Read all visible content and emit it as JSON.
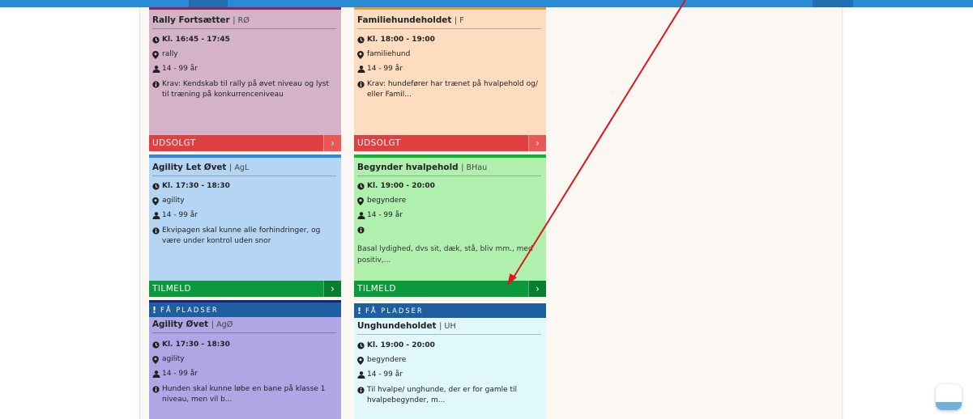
{
  "colors": {
    "accent": "#2b8ad6",
    "sold_out": "#e0403f",
    "register": "#0b9a3b",
    "few_seats": "#1d5fa0",
    "annotation_arrow": "#e0141b"
  },
  "icons": {
    "time": "clock-icon",
    "location": "map-marker-icon",
    "age": "user-icon",
    "info": "info-circle-icon",
    "action": "chevron-right-icon",
    "alert": "exclamation-icon"
  },
  "cards": [
    {
      "title": "Rally Fortsætter",
      "code": "RØ",
      "time": "Kl. 16:45 - 17:45",
      "location": "rally",
      "age": "14 - 99 år",
      "info": "Krav: Kendskab til rally på øvet niveau og lyst til træning på konkurrenceniveau",
      "action": "UDSOLGT"
    },
    {
      "title": "Familiehundeholdet",
      "code": "F",
      "time": "Kl. 18:00 - 19:00",
      "location": "familiehund",
      "age": "14 - 99 år",
      "info": "Krav: hundefører har trænet på hvalpehold og/ eller Famil...",
      "action": "UDSOLGT"
    },
    {
      "title": "Agility Let Øvet",
      "code": "AgL",
      "time": "Kl. 17:30 - 18:30",
      "location": "agility",
      "age": "14 - 99 år",
      "info": "Ekvipagen skal kunne alle forhindringer, og være under kontrol uden snor",
      "action": "TILMELD"
    },
    {
      "title": "Begynder hvalpehold",
      "code": "BHau",
      "time": "Kl. 19:00 - 20:00",
      "location": "begyndere",
      "age": "14 - 99 år",
      "info": "",
      "description": "Basal lydighed, dvs sit, dæk, stå, bliv mm., med positiv,...",
      "action": "TILMELD"
    },
    {
      "banner": "FÅ PLADSER",
      "title": "Agility Øvet",
      "code": "AgØ",
      "time": "Kl. 17:30 - 18:30",
      "location": "agility",
      "age": "14 - 99 år",
      "info": "Hunden skal kunne løbe en bane på klasse 1 niveau, men vil b..."
    },
    {
      "banner": "FÅ PLADSER",
      "title": "Unghundeholdet",
      "code": "UH",
      "time": "Kl. 19:00 - 20:00",
      "location": "begyndere",
      "age": "14 - 99 år",
      "info": "Til hvalpe/ unghunde, der er for gamle til hvalpebegynder, m..."
    }
  ],
  "code_separator": "|",
  "chevron_glyph": "›",
  "alert_glyph": "!"
}
